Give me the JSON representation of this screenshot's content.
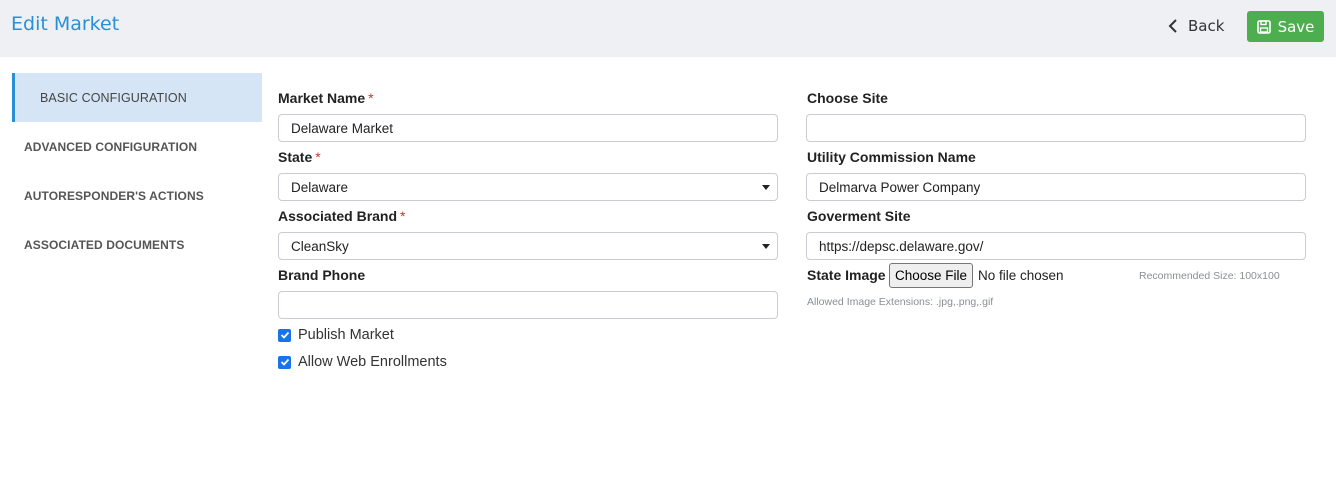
{
  "header": {
    "title": "Edit Market",
    "back_label": "Back",
    "save_label": "Save",
    "save_color": "#4cae4f",
    "accent_color": "#2b8fd6"
  },
  "sidebar": {
    "items": [
      {
        "label": "BASIC CONFIGURATION",
        "active": true
      },
      {
        "label": "ADVANCED CONFIGURATION",
        "active": false
      },
      {
        "label": "AUTORESPONDER'S ACTIONS",
        "active": false
      },
      {
        "label": "ASSOCIATED DOCUMENTS",
        "active": false
      }
    ]
  },
  "form": {
    "market_name": {
      "label": "Market Name",
      "required": "*",
      "value": "Delaware Market"
    },
    "state": {
      "label": "State",
      "required": "*",
      "value": "Delaware"
    },
    "associated_brand": {
      "label": "Associated Brand",
      "required": "*",
      "value": "CleanSky"
    },
    "brand_phone": {
      "label": "Brand Phone",
      "value": ""
    },
    "publish_market": {
      "label": "Publish Market",
      "checked": true
    },
    "allow_web_enrollments": {
      "label": "Allow Web Enrollments",
      "checked": true
    },
    "choose_site": {
      "label": "Choose Site",
      "value": ""
    },
    "utility_commission_name": {
      "label": "Utility Commission Name",
      "value": "Delmarva Power Company"
    },
    "government_site": {
      "label": "Goverment Site",
      "value": "https://depsc.delaware.gov/"
    },
    "state_image": {
      "label": "State Image",
      "button_label": "Choose File",
      "status": "No file chosen",
      "recommended_size": "Recommended Size: 100x100",
      "allowed_extensions": "Allowed Image Extensions: .jpg,.png,.gif"
    }
  }
}
